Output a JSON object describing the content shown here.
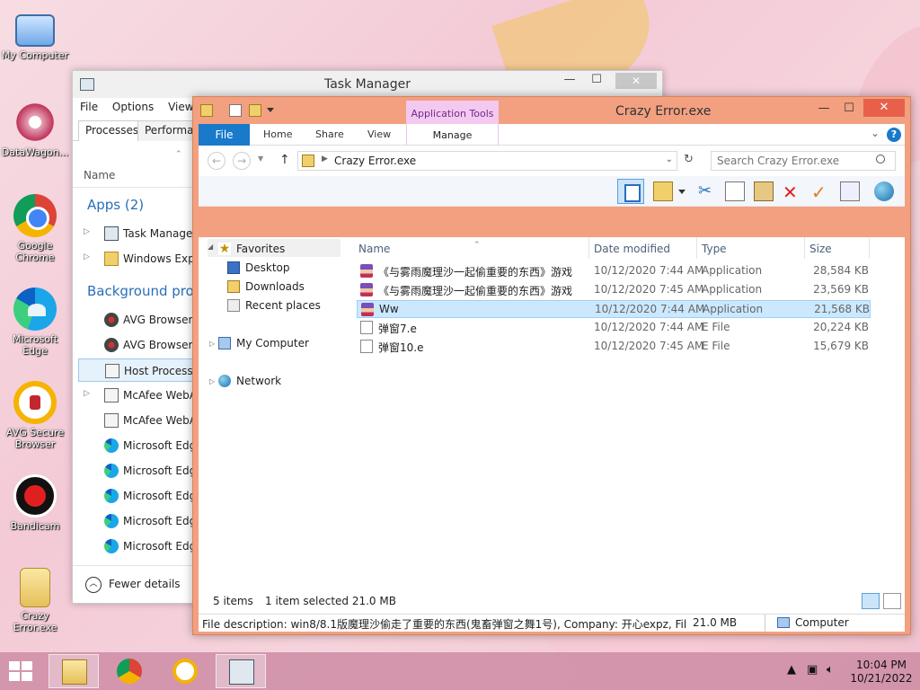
{
  "desktop": {
    "icons": [
      {
        "label": "My Computer"
      },
      {
        "label": "DataWagon..."
      },
      {
        "label": "Google Chrome"
      },
      {
        "label": "Microsoft Edge"
      },
      {
        "label": "AVG Secure Browser"
      },
      {
        "label": "Bandicam"
      },
      {
        "label": "Crazy Error.exe"
      }
    ]
  },
  "taskmanager": {
    "title": "Task Manager",
    "menu": [
      "File",
      "Options",
      "View"
    ],
    "tabs": [
      "Processes",
      "Performan"
    ],
    "column_name": "Name",
    "apps_group": "Apps (2)",
    "apps": [
      "Task Manager",
      "Windows Explo"
    ],
    "bg_group": "Background proc",
    "background": [
      "AVG Browser C",
      "AVG Browser C",
      "Host Process fo",
      "McAfee WebA",
      "McAfee WebA",
      "Microsoft Edge",
      "Microsoft Edge",
      "Microsoft Edge",
      "Microsoft Edge",
      "Microsoft Edge"
    ],
    "fewer_details": "Fewer details"
  },
  "explorer": {
    "title": "Crazy Error.exe",
    "context_tab": "Application Tools",
    "ribbon_tabs": [
      "File",
      "Home",
      "Share",
      "View",
      "Manage"
    ],
    "address": "Crazy Error.exe",
    "search_placeholder": "Search Crazy Error.exe",
    "nav": {
      "favorites": "Favorites",
      "desktop": "Desktop",
      "downloads": "Downloads",
      "recent": "Recent places",
      "computer": "My Computer",
      "network": "Network"
    },
    "columns": {
      "name": "Name",
      "date": "Date modified",
      "type": "Type",
      "size": "Size"
    },
    "files": [
      {
        "name": "《与雾雨魔理沙一起偷重要的东西》游戏",
        "date": "10/12/2020 7:44 AM",
        "type": "Application",
        "size": "28,584 KB"
      },
      {
        "name": "《与雾雨魔理沙一起偷重要的东西》游戏",
        "date": "10/12/2020 7:45 AM",
        "type": "Application",
        "size": "23,569 KB"
      },
      {
        "name": "Ww",
        "date": "10/12/2020 7:44 AM",
        "type": "Application",
        "size": "21,568 KB"
      },
      {
        "name": "弹窗7.e",
        "date": "10/12/2020 7:44 AM",
        "type": "E File",
        "size": "20,224 KB"
      },
      {
        "name": "弹窗10.e",
        "date": "10/12/2020 7:45 AM",
        "type": "E File",
        "size": "15,679 KB"
      }
    ],
    "status": {
      "items": "5 items",
      "selected": "1 item selected  21.0 MB"
    },
    "details": {
      "description": "File description: win8/8.1版魔理沙偷走了重要的东西(鬼畜弹窗之舞1号), Company: 开心expz, File ve",
      "size": "21.0 MB",
      "location": "Computer"
    }
  },
  "taskbar": {
    "time": "10:04 PM",
    "date": "10/21/2022"
  }
}
